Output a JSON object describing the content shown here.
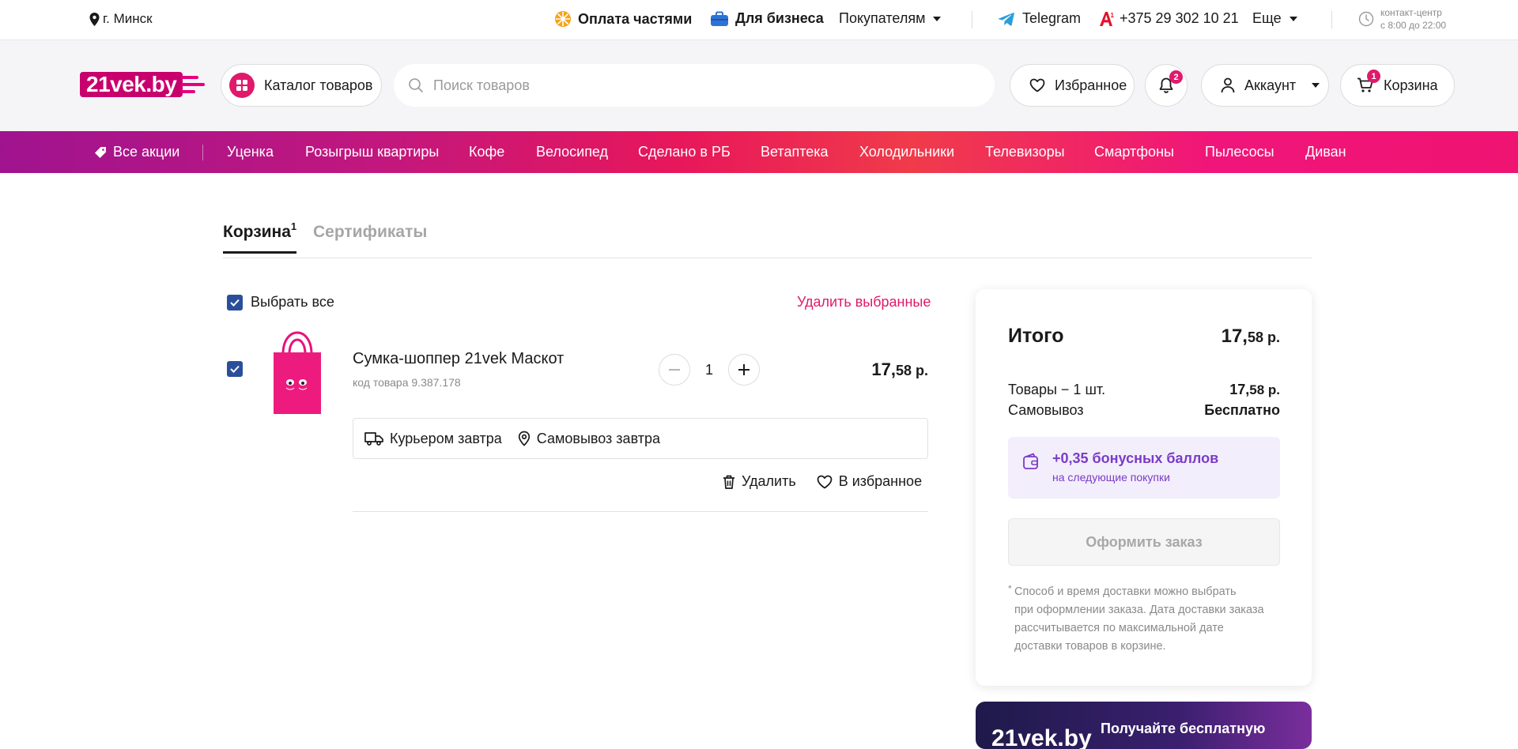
{
  "topbar": {
    "city": "г. Минск",
    "installments": "Оплата частями",
    "business": "Для бизнеса",
    "buyers": "Покупателям",
    "telegram": "Telegram",
    "phone": "+375 29 302 10 21",
    "more": "Еще",
    "contact_center": "контакт-центр",
    "hours": "с 8:00 до 22:00"
  },
  "header": {
    "logo": "21vek.by",
    "catalog": "Каталог товаров",
    "search_placeholder": "Поиск товаров",
    "favorites": "Избранное",
    "notifications_count": "2",
    "account": "Аккаунт",
    "cart": "Корзина",
    "cart_count": "1"
  },
  "promo_nav": {
    "all_promos": "Все акции",
    "items": [
      "Уценка",
      "Розыгрыш квартиры",
      "Кофе",
      "Велосипед",
      "Сделано в РБ",
      "Ветаптека",
      "Холодильники",
      "Телевизоры",
      "Смартфоны",
      "Пылесосы",
      "Диван"
    ]
  },
  "tabs": {
    "cart": "Корзина",
    "cart_count": "1",
    "certificates": "Сертификаты"
  },
  "cart": {
    "select_all": "Выбрать все",
    "delete_selected": "Удалить выбранные",
    "item": {
      "name": "Сумка-шоппер 21vek Маскот",
      "code": "код товара 9.387.178",
      "quantity": "1",
      "price_int": "17,",
      "price_frac": "58 р.",
      "delivery_courier": "Курьером завтра",
      "delivery_pickup": "Самовывоз завтра",
      "delete": "Удалить",
      "to_favorites": "В избранное"
    }
  },
  "summary": {
    "title": "Итого",
    "total_int": "17,",
    "total_frac": "58 р.",
    "goods_label": "Товары − 1 шт.",
    "goods_int": "17,",
    "goods_frac": "58 р.",
    "pickup_label": "Самовывоз",
    "pickup_value": "Бесплатно",
    "bonus_main": "+0,35 бонусных баллов",
    "bonus_sub": "на следующие покупки",
    "checkout": "Оформить заказ",
    "note_mark": "*",
    "note_lines": [
      "Способ и время доставки можно выбрать",
      "при оформлении заказа. Дата доставки заказа",
      "рассчитывается по максимальной дате",
      "доставки товаров в корзине."
    ]
  },
  "banner": {
    "logo": "21vek.by",
    "text": "Получайте бесплатную"
  },
  "colors": {
    "accent": "#e0196b",
    "checkbox": "#2a4f9a",
    "bonus": "#7a3cc6"
  }
}
